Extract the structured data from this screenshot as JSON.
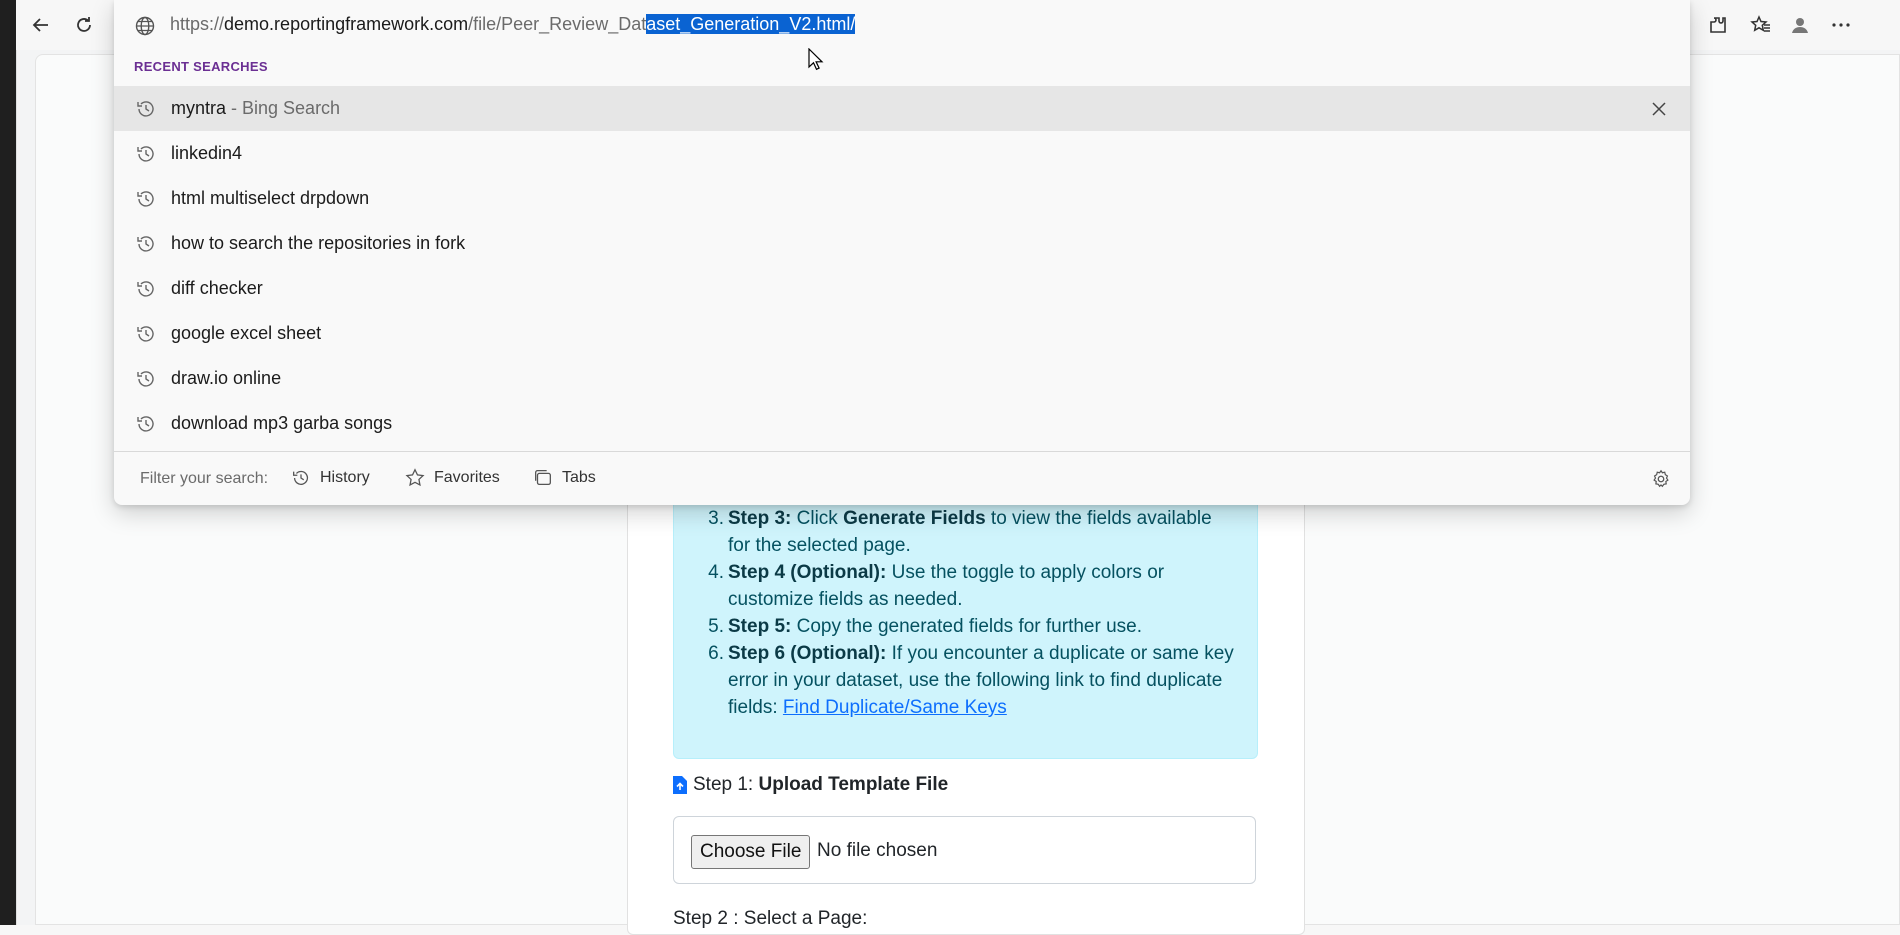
{
  "browser": {
    "url_scheme": "https://",
    "url_host": "demo.reportingframework.com",
    "url_path_plain": "/file/Peer_Review_Dat",
    "url_path_selected": "aset_Generation_V2.html/"
  },
  "dropdown": {
    "recent_header": "RECENT SEARCHES",
    "items": [
      {
        "text": "myntra",
        "suffix": " - Bing Search"
      },
      {
        "text": "linkedin4",
        "suffix": ""
      },
      {
        "text": "html multiselect drpdown",
        "suffix": ""
      },
      {
        "text": "how to search the repositories in fork",
        "suffix": ""
      },
      {
        "text": "diff checker",
        "suffix": ""
      },
      {
        "text": "google excel sheet",
        "suffix": ""
      },
      {
        "text": "draw.io online",
        "suffix": ""
      },
      {
        "text": "download mp3 garba songs",
        "suffix": ""
      }
    ],
    "filter_label": "Filter your search:",
    "filter_history": "History",
    "filter_favorites": "Favorites",
    "filter_tabs": "Tabs"
  },
  "page": {
    "steps": [
      {
        "num": "3.",
        "label": "Step 3:",
        "pre": " Click ",
        "bold2": "Generate Fields",
        "text": " to view the fields available for the selected page."
      },
      {
        "num": "4.",
        "label": "Step 4 (Optional):",
        "text": " Use the toggle to apply colors or customize fields as needed."
      },
      {
        "num": "5.",
        "label": "Step 5:",
        "text": " Copy the generated fields for further use."
      },
      {
        "num": "6.",
        "label": "Step 6 (Optional):",
        "text": " If you encounter a duplicate or same key error in your dataset, use the following link to find duplicate fields: ",
        "link": "Find Duplicate/Same Keys"
      }
    ],
    "step1_prefix": "Step 1: ",
    "step1_bold": "Upload Template File",
    "choose_file": "Choose File",
    "no_file": "No file chosen",
    "step2_label": "Step 2 : Select a Page:"
  },
  "colors": {
    "selection": "#0a63d2",
    "info_bg": "#cff4fc",
    "info_text": "#055160",
    "recent_header": "#6b2f93"
  },
  "icons": [
    "back-icon",
    "refresh-icon",
    "extensions-icon",
    "favorites-icon",
    "profile-icon",
    "more-icon",
    "globe-icon",
    "history-clock-icon",
    "close-icon",
    "star-icon",
    "tabs-icon",
    "gear-icon",
    "file-upload-icon",
    "cursor-icon"
  ]
}
